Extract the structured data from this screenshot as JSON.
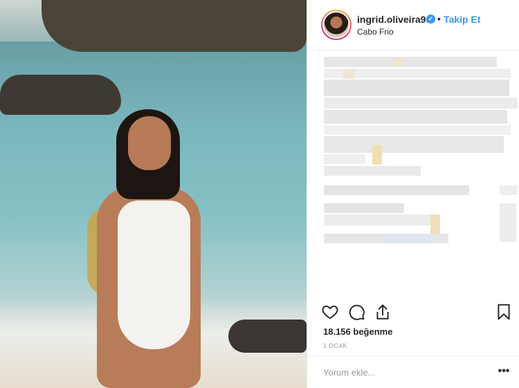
{
  "post": {
    "username": "ingrid.oliveira96",
    "follow_label": "Takip Et",
    "separator": "•",
    "location": "Cabo Frio",
    "likes_count": "18.156",
    "likes_label": "beğenme",
    "date": "1 OCAK",
    "caption_pixelated": true
  },
  "comment": {
    "placeholder": "Yorum ekle...",
    "more_label": "•••"
  },
  "icons": {
    "verified": "verified-badge-icon",
    "like": "heart-icon",
    "comment": "comment-bubble-icon",
    "share": "share-icon",
    "save": "bookmark-icon",
    "more": "more-options-icon"
  },
  "colors": {
    "accent": "#3897f0",
    "text": "#262626",
    "muted": "#999999",
    "border": "#efefef"
  }
}
